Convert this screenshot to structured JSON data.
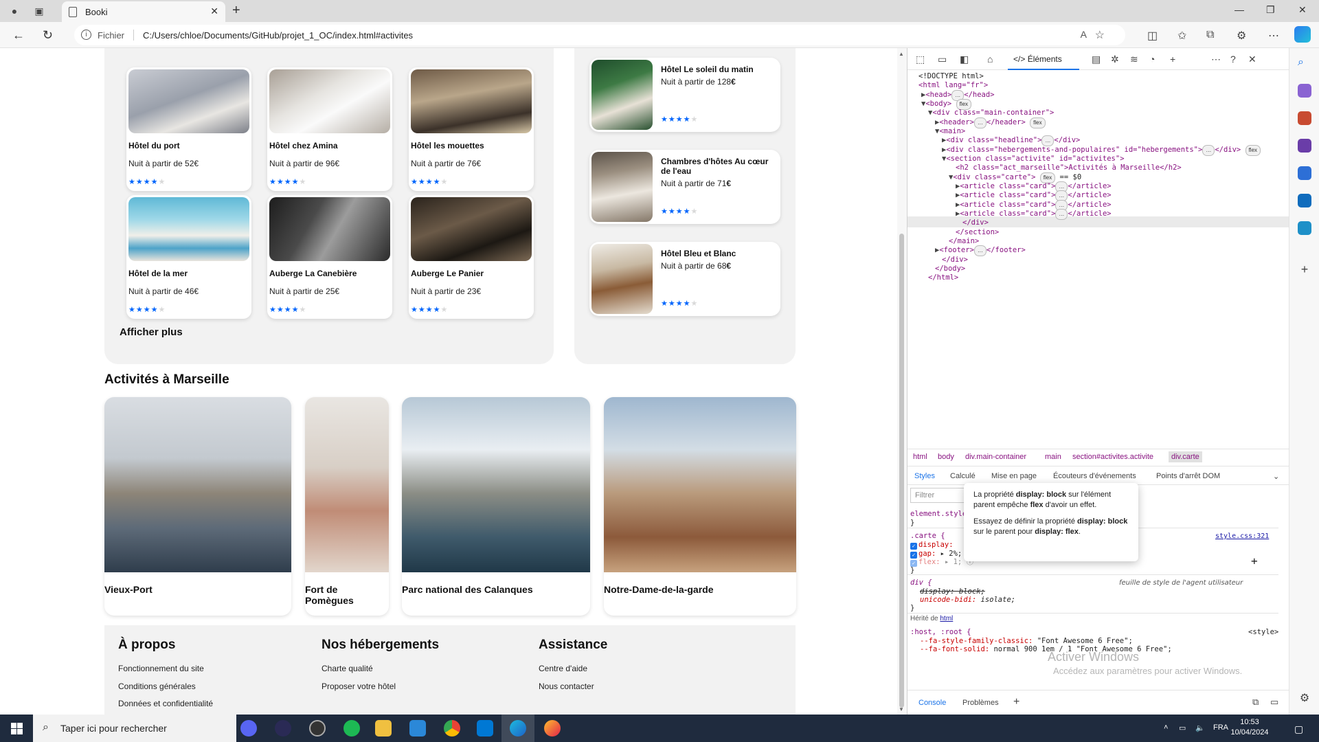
{
  "browser": {
    "tab_title": "Booki",
    "url_scheme_label": "Fichier",
    "url": "C:/Users/chloe/Documents/GitHub/projet_1_OC/index.html#activites"
  },
  "page": {
    "hotels": [
      {
        "name": "Hôtel du port",
        "price": "Nuit à partir de 52€",
        "stars": 4
      },
      {
        "name": "Hôtel chez Amina",
        "price": "Nuit à partir de 96€",
        "stars": 4
      },
      {
        "name": "Hôtel les mouettes",
        "price": "Nuit à partir de 76€",
        "stars": 4
      },
      {
        "name": "Hôtel de la mer",
        "price": "Nuit à partir de 46€",
        "stars": 4
      },
      {
        "name": "Auberge La Canebière",
        "price": "Nuit à partir de 25€",
        "stars": 4
      },
      {
        "name": "Auberge Le Panier",
        "price": "Nuit à partir de 23€",
        "stars": 4
      }
    ],
    "show_more": "Afficher plus",
    "popular": [
      {
        "name": "Hôtel Le soleil du matin",
        "price_prefix": "Nuit à partir de ",
        "price_value": "128",
        "price_currency": "€",
        "stars": 4
      },
      {
        "name": "Chambres d'hôtes Au cœur de l'eau",
        "price_prefix": "Nuit à partir de ",
        "price_value": "71",
        "price_currency": "€",
        "stars": 4
      },
      {
        "name": "Hôtel Bleu et Blanc",
        "price_prefix": "Nuit à partir de ",
        "price_value": "68",
        "price_currency": "€",
        "stars": 4
      }
    ],
    "activities_title": "Activités à Marseille",
    "activities": [
      {
        "name": "Vieux-Port"
      },
      {
        "name": "Fort de Pomègues"
      },
      {
        "name": "Parc national des Calanques"
      },
      {
        "name": "Notre-Dame-de-la-garde"
      }
    ],
    "footer": [
      {
        "title": "À propos",
        "links": [
          "Fonctionnement du site",
          "Conditions générales",
          "Données et confidentialité"
        ]
      },
      {
        "title": "Nos hébergements",
        "links": [
          "Charte qualité",
          "Proposer votre hôtel"
        ]
      },
      {
        "title": "Assistance",
        "links": [
          "Centre d'aide",
          "Nous contacter"
        ]
      }
    ]
  },
  "devtools": {
    "elements_tab": "Éléments",
    "dom": {
      "doctype": "<!DOCTYPE html>",
      "html_open": "<html lang=\"fr\">",
      "head": "<head>",
      "head_close": "</head>",
      "body": "<body>",
      "main_container": "<div class=\"main-container\">",
      "header": "<header>",
      "header_close": "</header>",
      "main": "<main>",
      "headline": "<div class=\"headline\">",
      "headline_close": "</div>",
      "hebergements": "<div class=\"hebergements-and-populaires\" id=\"hebergements\">",
      "hebergements_close": "</div>",
      "section": "<section class=\"activite\" id=\"activites\">",
      "h2": "<h2 class=\"act_marseille\">Activités à Marseille</h2>",
      "carte": "<div class=\"carte\">",
      "carte_eq": "== $0",
      "article": "<article class=\"card\">",
      "article_close": "</article>",
      "div_close": "</div>",
      "section_close": "</section>",
      "main_close": "</main>",
      "footer": "<footer>",
      "footer_close": "</footer>",
      "body_close": "</body>",
      "html_close": "</html>",
      "flex_badge": "flex",
      "ellipsis": "…"
    },
    "breadcrumbs": [
      "html",
      "body",
      "div.main-container",
      "main",
      "section#activites.activite",
      "div.carte"
    ],
    "style_tabs": [
      "Styles",
      "Calculé",
      "Mise en page",
      "Écouteurs d'événements",
      "Points d'arrêt DOM"
    ],
    "filter_placeholder": "Filtrer",
    "rules": {
      "element_style": "element.style {",
      "close_brace": "}",
      "carte_selector": ".carte {",
      "carte_source": "style.css:321",
      "display_prop": "display:",
      "gap_prop": "gap:",
      "gap_value": "▸ 2%;",
      "flex_prop": "flex:",
      "flex_value": "▸ 1;",
      "div_selector": "div {",
      "ua_label": "feuille de style de l'agent utilisateur",
      "ua_display": "display: block;",
      "ua_unicode": "unicode-bidi:",
      "ua_unicode_value": "isolate;",
      "inherited_prefix": "Hérité de ",
      "inherited_link": "html",
      "host_selector": ":host, :root {",
      "host_source": "<style>",
      "fa_classic_prop": "--fa-style-family-classic:",
      "fa_classic_value": "\"Font Awesome 6 Free\";",
      "fa_solid_prop": "--fa-font-solid:",
      "fa_solid_value": "normal 900 1em / 1 \"Font Awesome 6 Free\";"
    },
    "tooltip": {
      "line1_a": "La propriété ",
      "line1_b": "display: block",
      "line1_c": " sur l'élément parent empêche ",
      "line1_d": "flex",
      "line1_e": " d'avoir un effet.",
      "line2_a": "Essayez de définir la propriété ",
      "line2_b": "display: block",
      "line2_c": " sur le parent pour ",
      "line2_d": "display: flex",
      "line2_e": "."
    },
    "watermark_title": "Activer Windows",
    "watermark_sub": "Accédez aux paramètres pour activer Windows.",
    "drawer_tabs": [
      "Console",
      "Problèmes"
    ]
  },
  "taskbar": {
    "search_placeholder": "Taper ici pour rechercher",
    "lang": "FRA",
    "time": "10:53",
    "date": "10/04/2024"
  },
  "colors": {
    "accent": "#0065fc",
    "panel": "#f2f2f2",
    "devtools_blue": "#1a73e8",
    "taskbar": "#1f2b3e"
  }
}
